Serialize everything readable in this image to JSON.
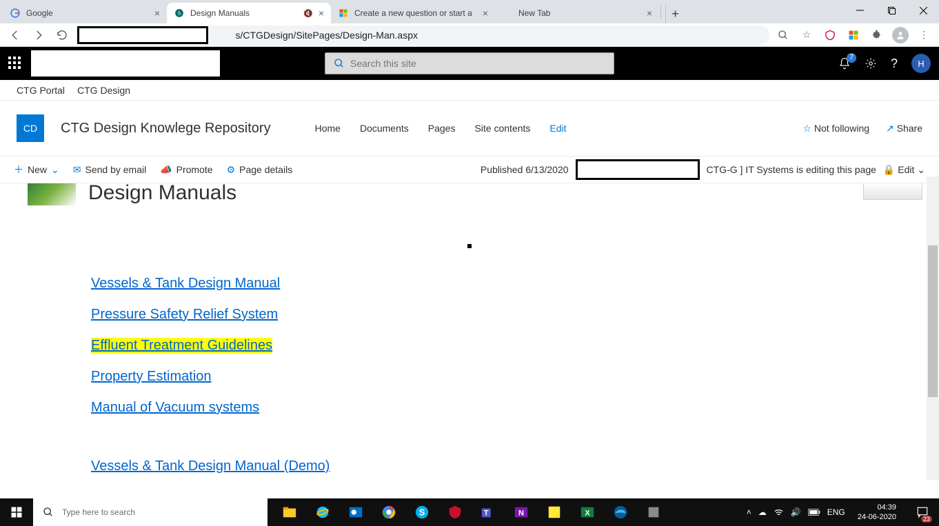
{
  "browser": {
    "tabs": [
      {
        "title": "Google"
      },
      {
        "title": "Design Manuals"
      },
      {
        "title": "Create a new question or start a"
      },
      {
        "title": "New Tab"
      }
    ],
    "url_suffix": "s/CTGDesign/SitePages/Design-Man.aspx"
  },
  "sp": {
    "search_placeholder": "Search this site",
    "notif_count": "7",
    "avatar": "H"
  },
  "crumb": {
    "a": "CTG Portal",
    "b": "CTG Design"
  },
  "site": {
    "logo": "CD",
    "title": "CTG Design Knowlege Repository",
    "nav": {
      "home": "Home",
      "documents": "Documents",
      "pages": "Pages",
      "contents": "Site contents",
      "edit": "Edit"
    },
    "follow": "Not following",
    "share": "Share"
  },
  "cmd": {
    "new": "New",
    "send": "Send by email",
    "promote": "Promote",
    "details": "Page details",
    "published": "Published 6/13/2020",
    "editing": "CTG-G ] IT Systems is editing this page",
    "edit": "Edit"
  },
  "page": {
    "title": "Design Manuals",
    "links": [
      "Vessels & Tank Design Manual",
      "Pressure Safety Relief System ",
      "Effluent Treatment Guidelines",
      "Property Estimation",
      "Manual of Vacuum systems"
    ],
    "demo_link": "Vessels & Tank Design Manual (Demo)"
  },
  "taskbar": {
    "search_placeholder": "Type here to search",
    "lang": "ENG",
    "time": "04:39",
    "date": "24-06-2020",
    "notif": "23"
  }
}
